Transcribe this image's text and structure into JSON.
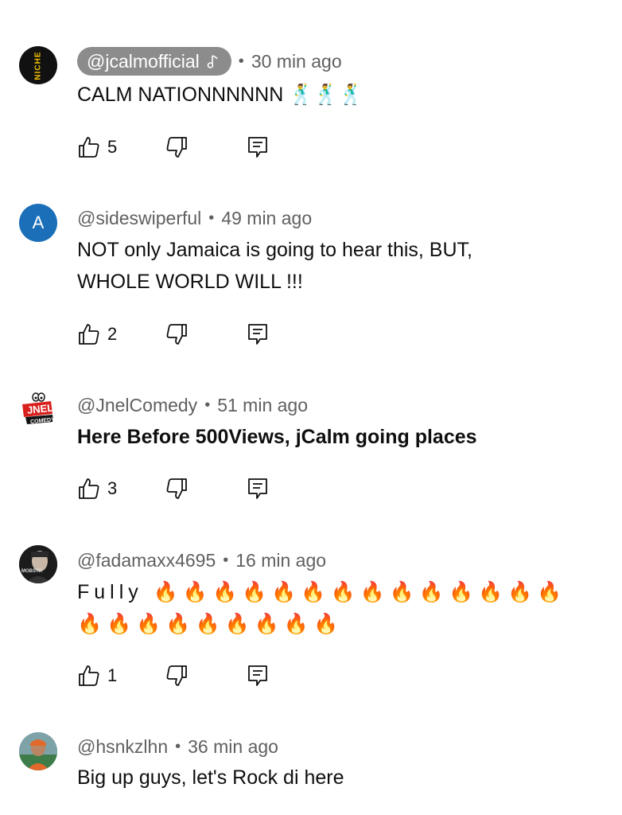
{
  "comments": [
    {
      "author": "@jcalmofficial",
      "creator_badge_icon": "music-note-icon",
      "time": "30 min ago",
      "text": "CALM NATIONNNNNN 🕺🕺🕺",
      "likes": "5",
      "avatar_text": "NICHE",
      "avatar_bg": "#111111",
      "avatar_fg": "#f2c200"
    },
    {
      "author": "@sideswiperful",
      "time": "49 min ago",
      "text": "NOT only Jamaica is going to hear this, BUT,\nWHOLE WORLD WILL !!!",
      "likes": "2",
      "avatar_text": "A",
      "avatar_bg": "#1a6fb8",
      "avatar_fg": "#ffffff"
    },
    {
      "author": "@JnelComedy",
      "time": "51 min ago",
      "text": "Here Before 500Views, jCalm going places",
      "likes": "3",
      "avatar_text": "JNEL COMEDY",
      "avatar_bg": "#ffffff",
      "avatar_fg": "#d8211f"
    },
    {
      "author": "@fadamaxx4695",
      "time": "16 min ago",
      "text": "Fully 🔥🔥🔥🔥🔥🔥🔥🔥🔥🔥🔥🔥🔥🔥\n🔥🔥🔥🔥🔥🔥🔥🔥🔥",
      "likes": "1",
      "avatar_text": "MOBSTR",
      "avatar_bg": "#1b1b1b",
      "avatar_fg": "#dddddd"
    },
    {
      "author": "@hsnkzlhn",
      "time": "36 min ago",
      "text": "Big up guys, let's Rock di here",
      "likes": "",
      "avatar_bg": "#7da2a8",
      "avatar_fg": "#e3692a"
    }
  ],
  "icons": {
    "like": "thumbs-up-icon",
    "dislike": "thumbs-down-icon",
    "reply": "reply-comment-icon"
  }
}
